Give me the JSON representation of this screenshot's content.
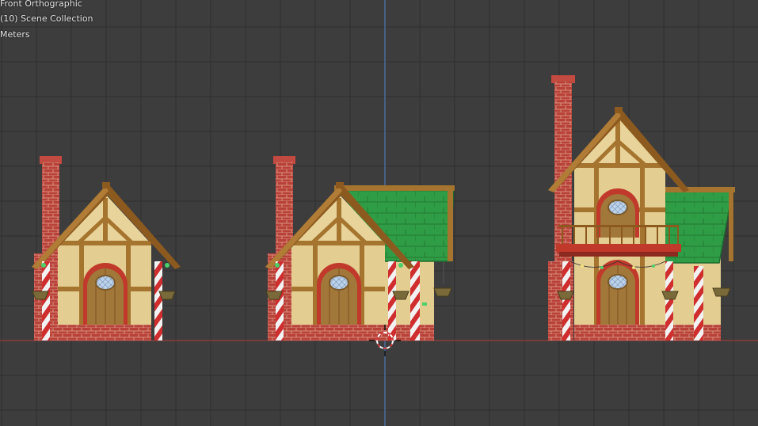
{
  "viewport": {
    "view_name": "Front Orthographic",
    "collection": "(10) Scene Collection",
    "units": "Meters"
  },
  "scene": {
    "objects": [
      {
        "name": "cottage-small"
      },
      {
        "name": "cottage-with-green-roof"
      },
      {
        "name": "cottage-two-story"
      }
    ]
  },
  "colors": {
    "background": "#3d3d3d",
    "grid_line": "#2f2f2f",
    "x_axis": "#8a3b3b",
    "z_axis": "#4b6c9e",
    "brick": "#b8423a",
    "roof_green": "#2f9d45",
    "timber": "#a5742f",
    "wall": "#e3cd90"
  }
}
